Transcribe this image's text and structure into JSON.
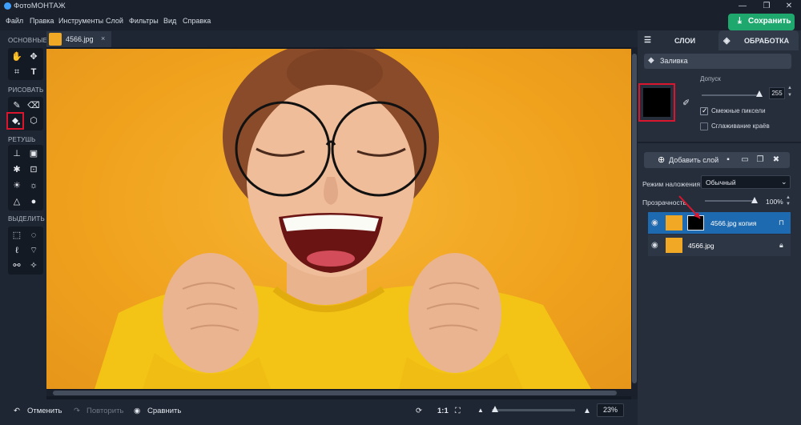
{
  "app": {
    "title": "ФотоМОНТАЖ",
    "window_controls": [
      "—",
      "❐",
      "✕"
    ]
  },
  "menu": {
    "items": [
      "Файл",
      "Правка",
      "Инструменты",
      "Слой",
      "Фильтры",
      "Вид",
      "Справка"
    ]
  },
  "save_button": {
    "label": "Сохранить",
    "icon": "download-icon"
  },
  "toolbar": {
    "groups": [
      {
        "label": "ОСНОВНЫЕ",
        "tools": [
          "hand-icon",
          "move-icon",
          "crop-icon",
          "text-icon"
        ]
      },
      {
        "label": "РИСОВАТЬ",
        "tools": [
          "brush-icon",
          "eraser-icon",
          "fill-bucket-icon",
          "shapes-icon"
        ],
        "active_tool": "fill-bucket-icon"
      },
      {
        "label": "РЕТУШЬ",
        "tools": [
          "stamp-icon",
          "patch-icon",
          "healing-icon",
          "frame-icon",
          "dodge-icon",
          "burn-icon",
          "sharpen-icon",
          "blur-drop-icon"
        ]
      },
      {
        "label": "ВЫДЕЛИТЬ",
        "tools": [
          "rect-select-icon",
          "ellipse-select-icon",
          "lasso-icon",
          "polygon-lasso-icon",
          "magic-lasso-icon",
          "magic-wand-icon"
        ]
      }
    ]
  },
  "document_tab": {
    "name": "4566.jpg",
    "close": "×"
  },
  "bottom_bar": {
    "undo_label": "Отменить",
    "redo_label": "Повторить",
    "compare_label": "Сравнить",
    "ratio_label": "1:1",
    "zoom_value": "23%",
    "zoom_level": 0.04
  },
  "right_panel": {
    "tabs": [
      {
        "label": "СЛОИ",
        "icon": "sliders-icon",
        "active": true
      },
      {
        "label": "ОБРАБОТКА",
        "icon": "layers-stack-icon",
        "active": false
      }
    ],
    "tool_name": "Заливка",
    "fill_color": "#000000",
    "tolerance": {
      "label": "Допуск",
      "value": "255"
    },
    "options": [
      {
        "label": "Смежные пиксели",
        "checked": true
      },
      {
        "label": "Сглаживание краёв",
        "checked": false
      }
    ],
    "add_layer_label": "Добавить слой",
    "blend": {
      "label": "Режим наложения:",
      "value": "Обычный"
    },
    "opacity": {
      "label": "Прозрачность",
      "value": "100%"
    },
    "layers": [
      {
        "name": "4566.jpg копия",
        "selected": true,
        "has_mask": true
      },
      {
        "name": "4566.jpg",
        "selected": false,
        "has_mask": false
      }
    ]
  },
  "colors": {
    "accent": "#1ea86e",
    "selection": "#1e6ab0",
    "highlight": "#d9162e",
    "photo_bg": "#f0a21d"
  }
}
